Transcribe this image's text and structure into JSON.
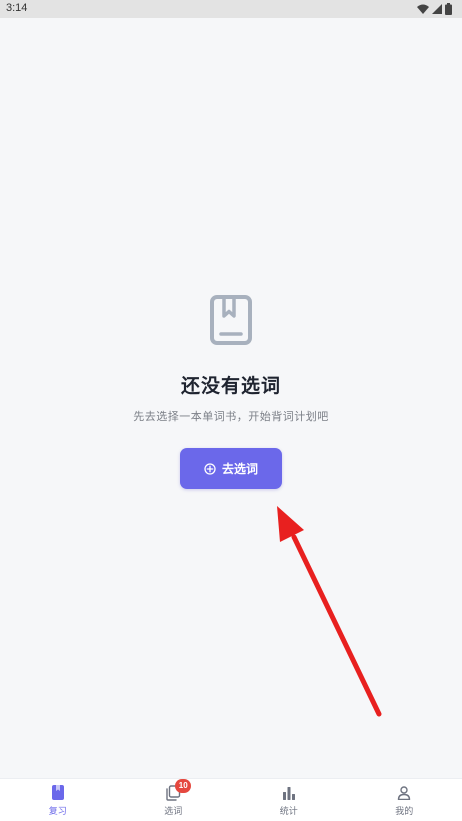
{
  "status_bar": {
    "time": "3:14",
    "icons": [
      "wifi-icon",
      "signal-icon",
      "battery-icon"
    ]
  },
  "empty_state": {
    "icon": "book-bookmark-icon",
    "title": "还没有选词",
    "subtitle": "先去选择一本单词书，开始背词计划吧",
    "button_label": "去选词",
    "button_icon": "plus-circle-icon"
  },
  "bottom_nav": {
    "items": [
      {
        "label": "复习",
        "icon": "book-icon",
        "active": true
      },
      {
        "label": "选词",
        "icon": "cards-icon",
        "badge": "10"
      },
      {
        "label": "统计",
        "icon": "bar-chart-icon"
      },
      {
        "label": "我的",
        "icon": "user-icon"
      }
    ]
  },
  "colors": {
    "accent": "#6b68ea",
    "background": "#f6f7f9",
    "badge": "#e5483f",
    "annotation_arrow": "#e8201f"
  }
}
